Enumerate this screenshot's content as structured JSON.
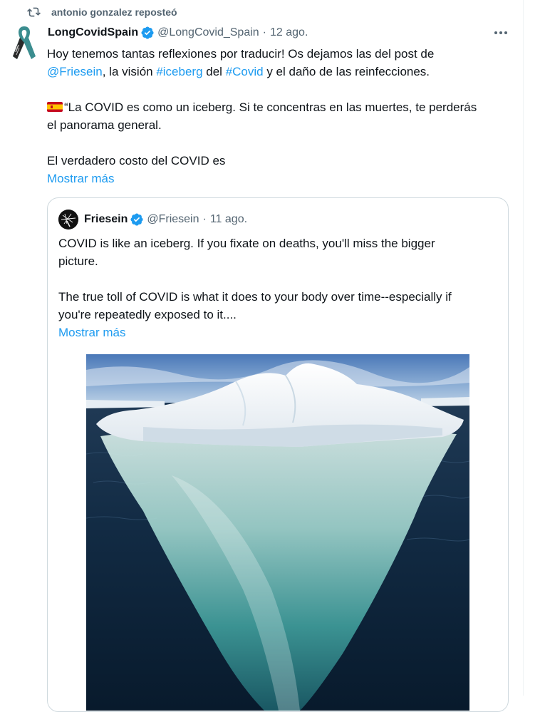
{
  "repost": {
    "icon": "repost-icon",
    "text": "antonio gonzalez reposteó"
  },
  "tweet": {
    "avatar_icon": "ribbon-avatar-icon",
    "name": "LongCovidSpain",
    "verified_icon": "verified-badge-icon",
    "handle": "@LongCovid_Spain",
    "separator": "·",
    "date": "12 ago.",
    "more_icon": "more-options-icon",
    "line1": "Hoy tenemos tantas reflexiones por traducir! Os dejamos las del post de",
    "mention": "@Friesein",
    "line2a": ", la visión ",
    "hashtag1": "#iceberg",
    "line2b": " del ",
    "hashtag2": "#Covid",
    "line2c": " y el daño de las reinfecciones.",
    "flag_icon": "spain-flag-icon",
    "quote_line1": "“La COVID es como un iceberg. Si te concentras en las muertes, te perderás",
    "quote_line2": "el panorama general.",
    "line_last": "El verdadero costo del COVID es",
    "show_more": "Mostrar más"
  },
  "quoted": {
    "avatar_icon": "friesein-avatar-icon",
    "name": "Friesein",
    "verified_icon": "verified-badge-icon",
    "handle": "@Friesein",
    "separator": "·",
    "date": "11 ago.",
    "line1": "COVID is like an iceberg. If you fixate on deaths, you'll miss the bigger",
    "line2": "picture.",
    "line3": "The true toll of COVID is what it does to your body over time--especially if",
    "line4": "you're repeatedly exposed to it....",
    "show_more": "Mostrar más",
    "image_description": "iceberg-photo"
  },
  "colors": {
    "link": "#1d9bf0",
    "secondary_text": "#536471",
    "primary_text": "#0f1419",
    "border": "#cfd9de"
  }
}
